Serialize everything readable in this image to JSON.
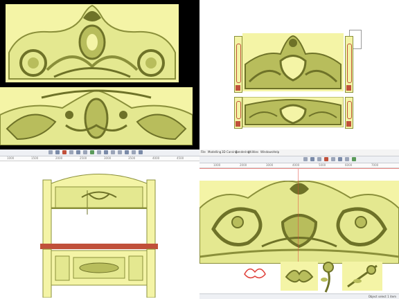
{
  "colors": {
    "carving_base": "#f4f4a6",
    "carving_light": "#e4e890",
    "carving_mid": "#b8bd5c",
    "carving_dark": "#6e7228",
    "relief_outline": "#8a8f3a",
    "wood_red": "#c0503a",
    "guide_red": "#e0403a",
    "toolbar_bg": "#eef0f4"
  },
  "panels": {
    "top_left": {
      "name": "black-canvas-two-headboard-reliefs",
      "background": "#000000"
    },
    "top_right": {
      "name": "headboard-footboard-with-side-posts",
      "background": "#ffffff"
    },
    "bottom_left": {
      "name": "cad-bed-frame-layout",
      "background": "#ffffff"
    },
    "bottom_right": {
      "name": "cad-headboard-relief-detail",
      "background": "#ffffff"
    }
  },
  "cad_left": {
    "ruler_ticks": [
      "1000",
      "1500",
      "2000",
      "2500",
      "3000",
      "3500",
      "4000",
      "4500"
    ]
  },
  "cad_right": {
    "menu": [
      "File",
      "Modelling",
      "3D Carving",
      "Rendering",
      "Utilities",
      "Windows",
      "Help"
    ],
    "ruler_ticks": [
      "1000",
      "2000",
      "3000",
      "4000",
      "5000",
      "6000",
      "7000"
    ],
    "status_text": "Object select  1 item"
  }
}
